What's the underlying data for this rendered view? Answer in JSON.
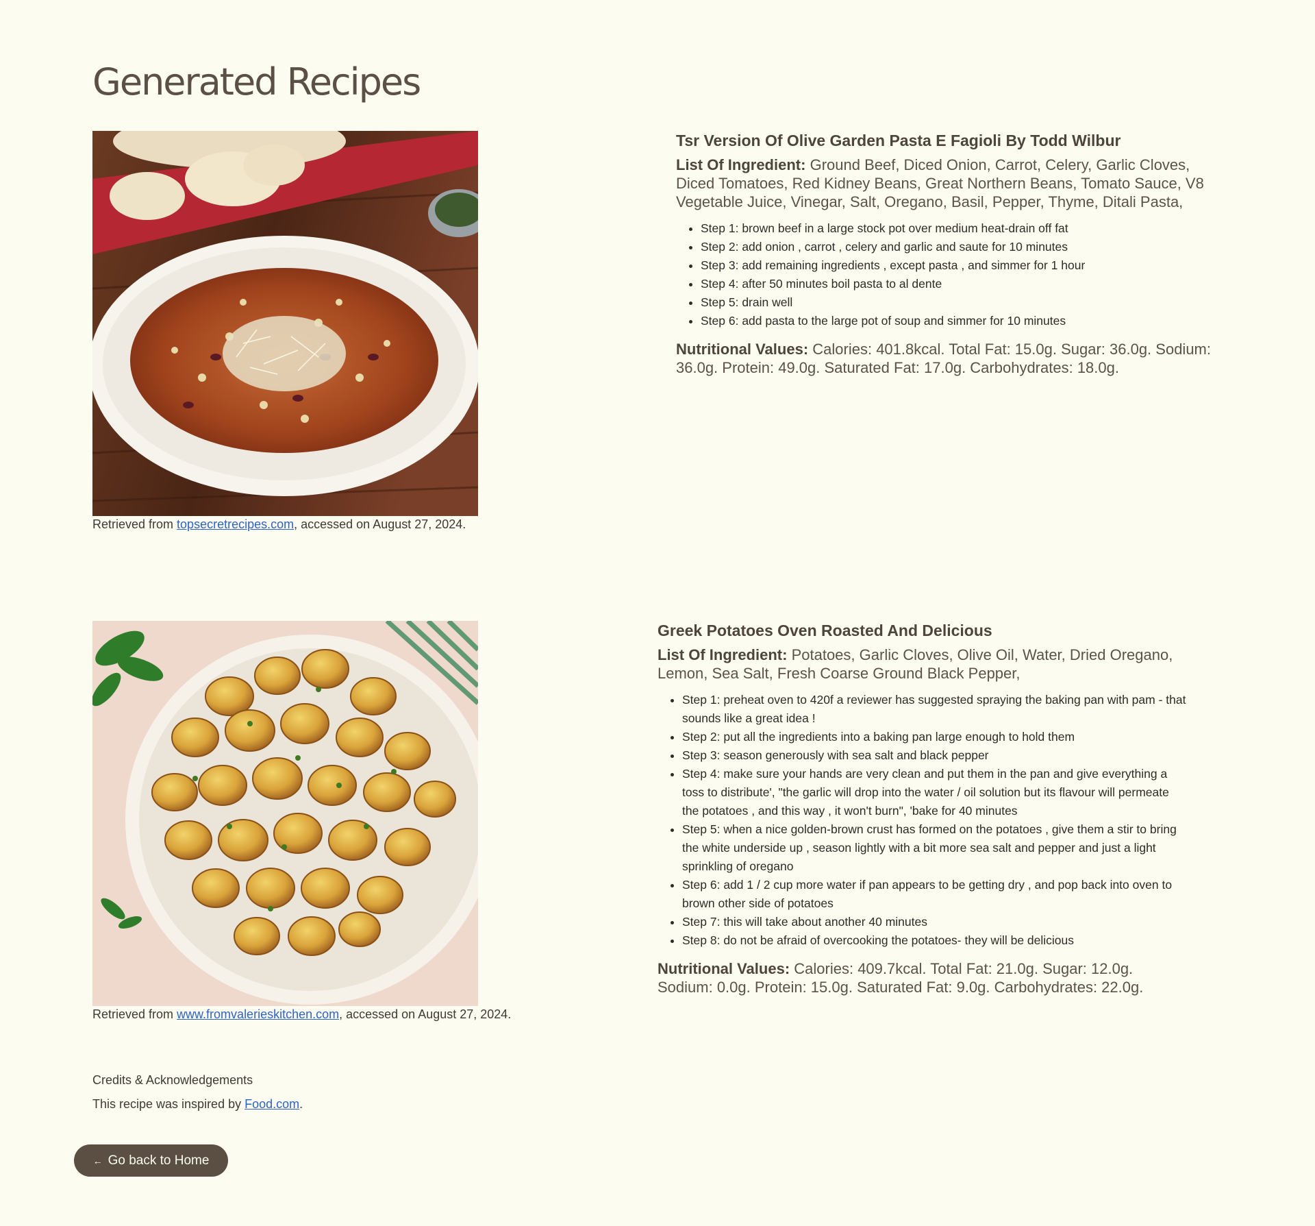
{
  "page_title": "Generated Recipes",
  "recipes": [
    {
      "title": "Tsr Version Of Olive Garden Pasta E Fagioli By Todd Wilbur",
      "ingredients_label": "List Of Ingredient:",
      "ingredients": "Ground Beef, Diced Onion, Carrot, Celery, Garlic Cloves, Diced Tomatoes, Red Kidney Beans, Great Northern Beans, Tomato Sauce, V8 Vegetable Juice, Vinegar, Salt, Oregano, Basil, Pepper, Thyme, Ditali Pasta,",
      "steps": [
        "Step 1: brown beef in a large stock pot over medium heat-drain off fat",
        "Step 2: add onion , carrot , celery and garlic and saute for 10 minutes",
        "Step 3: add remaining ingredients , except pasta , and simmer for 1 hour",
        "Step 4: after 50 minutes boil pasta to al dente",
        "Step 5: drain well",
        "Step 6: add pasta to the large pot of soup and simmer for 10 minutes"
      ],
      "nutrition_label": "Nutritional Values:",
      "nutrition": "Calories: 401.8kcal. Total Fat: 15.0g. Sugar: 36.0g. Sodium: 36.0g. Protein: 49.0g. Saturated Fat: 17.0g. Carbohydrates: 18.0g.",
      "caption_prefix": "Retrieved from ",
      "source_link": "topsecretrecipes.com",
      "caption_suffix": ", accessed on August 27, 2024."
    },
    {
      "title": "Greek Potatoes Oven Roasted And Delicious",
      "ingredients_label": "List Of Ingredient:",
      "ingredients": "Potatoes, Garlic Cloves, Olive Oil, Water, Dried Oregano, Lemon, Sea Salt, Fresh Coarse Ground Black Pepper,",
      "steps": [
        "Step 1: preheat oven to 420f a reviewer has suggested spraying the baking pan with pam - that sounds like a great idea !",
        "Step 2: put all the ingredients into a baking pan large enough to hold them",
        "Step 3: season generously with sea salt and black pepper",
        "Step 4: make sure your hands are very clean and put them in the pan and give everything a toss to distribute', \"the garlic will drop into the water / oil solution but its flavour will permeate the potatoes , and this way , it won't burn\", 'bake for 40 minutes",
        "Step 5: when a nice golden-brown crust has formed on the potatoes , give them a stir to bring the white underside up , season lightly with a bit more sea salt and pepper and just a light sprinkling of oregano",
        "Step 6: add 1 / 2 cup more water if pan appears to be getting dry , and pop back into oven to brown other side of potatoes",
        "Step 7: this will take about another 40 minutes",
        "Step 8: do not be afraid of overcooking the potatoes- they will be delicious"
      ],
      "nutrition_label": "Nutritional Values:",
      "nutrition": "Calories: 409.7kcal. Total Fat: 21.0g. Sugar: 12.0g. Sodium: 0.0g. Protein: 15.0g. Saturated Fat: 9.0g. Carbohydrates: 22.0g.",
      "caption_prefix": "Retrieved from ",
      "source_link": "www.fromvalerieskitchen.com",
      "caption_suffix": ", accessed on August 27, 2024."
    }
  ],
  "credits": {
    "heading": "Credits & Acknowledgements",
    "text_prefix": "This recipe was inspired by ",
    "link": "Food.com",
    "text_suffix": "."
  },
  "home_button": {
    "arrow": "←",
    "label": "Go back to Home"
  },
  "colors": {
    "background": "#fdfcf1",
    "text": "#4a4239",
    "link": "#2d63c8",
    "button_bg": "#5a4f42"
  },
  "icons": [
    "arrow-left-icon"
  ]
}
